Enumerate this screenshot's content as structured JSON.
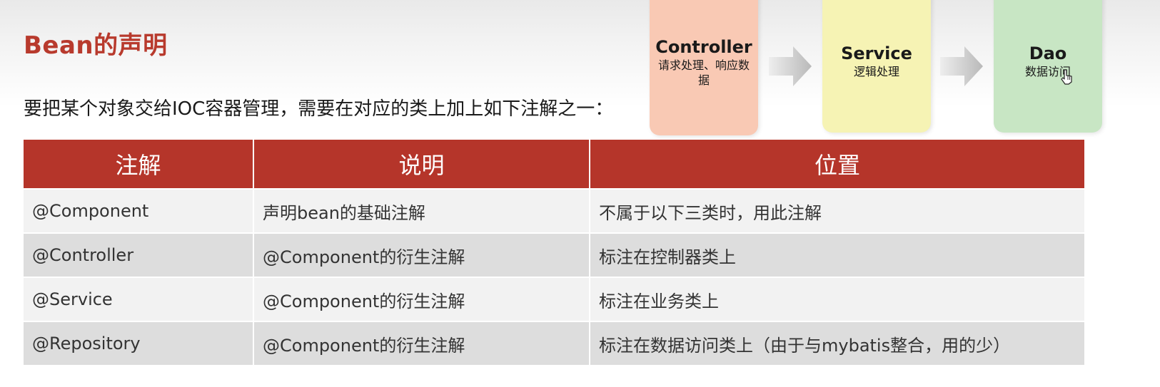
{
  "page": {
    "title": "Bean的声明",
    "subtitle": "要把某个对象交给IOC容器管理，需要在对应的类上加上如下注解之一："
  },
  "layers": [
    {
      "name": "Controller",
      "desc": "请求处理、响应数据",
      "color": "#f9c9b4"
    },
    {
      "name": "Service",
      "desc": "逻辑处理",
      "color": "#f6f3b4"
    },
    {
      "name": "Dao",
      "desc": "数据访问",
      "color": "#c8e6c4"
    }
  ],
  "table": {
    "headers": [
      "注解",
      "说明",
      "位置"
    ],
    "rows": [
      [
        "@Component",
        "声明bean的基础注解",
        "不属于以下三类时，用此注解"
      ],
      [
        "@Controller",
        "@Component的衍生注解",
        "标注在控制器类上"
      ],
      [
        "@Service",
        "@Component的衍生注解",
        "标注在业务类上"
      ],
      [
        "@Repository",
        "@Component的衍生注解",
        "标注在数据访问类上（由于与mybatis整合，用的少）"
      ]
    ]
  },
  "colors": {
    "accent": "#b83a2d",
    "header_bg": "#b5352a"
  }
}
